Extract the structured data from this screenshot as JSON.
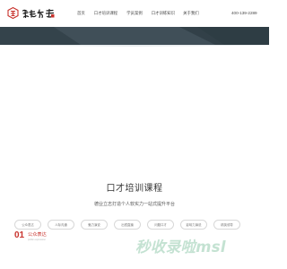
{
  "header": {
    "logo_icon": "seal-logo-icon",
    "nav": [
      {
        "label": "首页"
      },
      {
        "label": "口才培训课程"
      },
      {
        "label": "学员案例"
      },
      {
        "label": "口才训练知识"
      },
      {
        "label": "关于我们"
      }
    ],
    "phone": "400-139-2289"
  },
  "course_section": {
    "title": "口才培训课程",
    "subtitle": "德业立志打造个人软实力一站式提升平台",
    "tags": [
      {
        "label": "公众表达"
      },
      {
        "label": "人际沟通"
      },
      {
        "label": "魅力演说"
      },
      {
        "label": "出镜直播"
      },
      {
        "label": "问题口才"
      },
      {
        "label": "影响力演说"
      },
      {
        "label": "精英领导"
      }
    ]
  },
  "feature_section": {
    "number": "01",
    "title": "公众表达",
    "subtitle": "public expression"
  },
  "watermark": "秒收录啦msl",
  "colors": {
    "accent": "#c8322c",
    "hero": "#3b4a53",
    "watermark": "#c4e2d2",
    "tag_border": "#d8d8d8"
  }
}
